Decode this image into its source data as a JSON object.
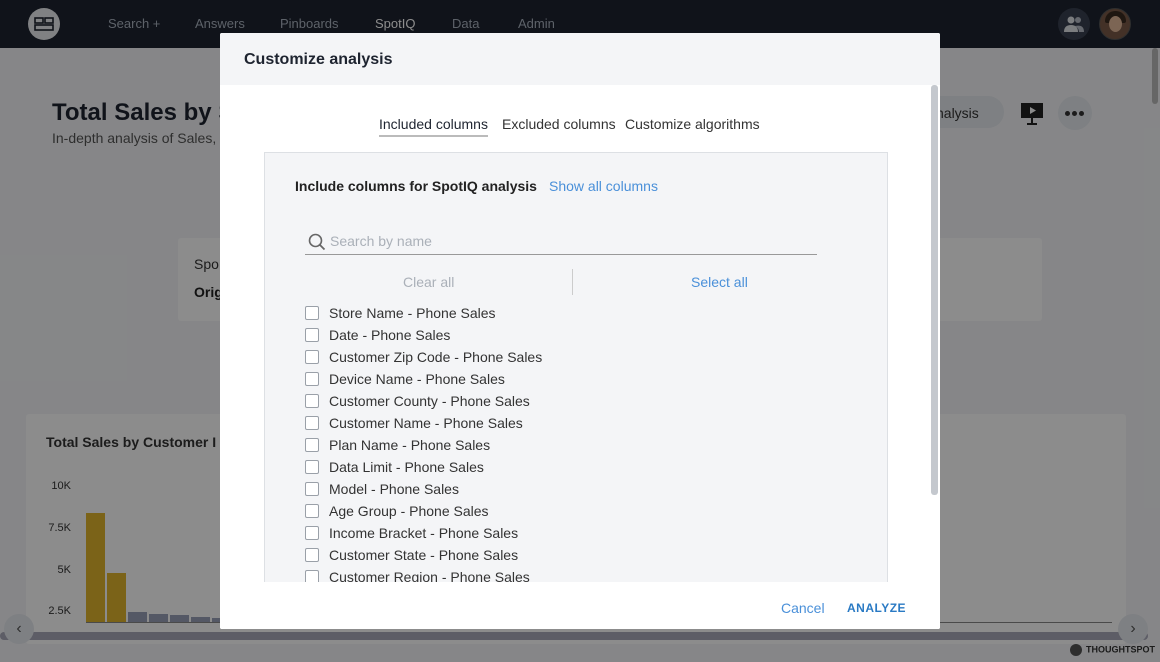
{
  "nav": {
    "items": [
      "Search +",
      "Answers",
      "Pinboards",
      "SpotIQ",
      "Data",
      "Admin"
    ],
    "active": "SpotIQ"
  },
  "background": {
    "title": "Total Sales by S",
    "subtitle": "In-depth analysis of Sales,",
    "pill_label": "nalysis",
    "card1_line1": "Spo",
    "card1_line2": "Orig",
    "chart_title": "Total Sales by Customer I",
    "y_ticks": [
      "10K",
      "7.5K",
      "5K",
      "2.5K"
    ],
    "brand": "THOUGHTSPOT"
  },
  "chart_data": {
    "type": "bar",
    "title": "Total Sales by Customer I",
    "xlabel": "",
    "ylabel": "",
    "ylim": [
      0,
      10000
    ],
    "series": [
      {
        "values": [
          8000,
          3600
        ],
        "color": "#e0b52c"
      },
      {
        "values": [
          700,
          600,
          500,
          400,
          300,
          200
        ],
        "color": "#9aa0b8"
      }
    ]
  },
  "modal": {
    "title": "Customize analysis",
    "tabs": [
      "Included columns",
      "Excluded columns",
      "Customize algorithms"
    ],
    "active_tab": "Included columns",
    "panel_title": "Include columns for SpotIQ analysis",
    "show_all_label": "Show all columns",
    "search_placeholder": "Search by name",
    "clear_all_label": "Clear all",
    "select_all_label": "Select all",
    "columns": [
      "Store Name - Phone Sales",
      "Date - Phone Sales",
      "Customer Zip Code - Phone Sales",
      "Device Name - Phone Sales",
      "Customer County - Phone Sales",
      "Customer Name - Phone Sales",
      "Plan Name - Phone Sales",
      "Data Limit - Phone Sales",
      "Model - Phone Sales",
      "Age Group - Phone Sales",
      "Income Bracket - Phone Sales",
      "Customer State - Phone Sales",
      "Customer Region - Phone Sales"
    ],
    "cancel_label": "Cancel",
    "analyze_label": "ANALYZE"
  }
}
